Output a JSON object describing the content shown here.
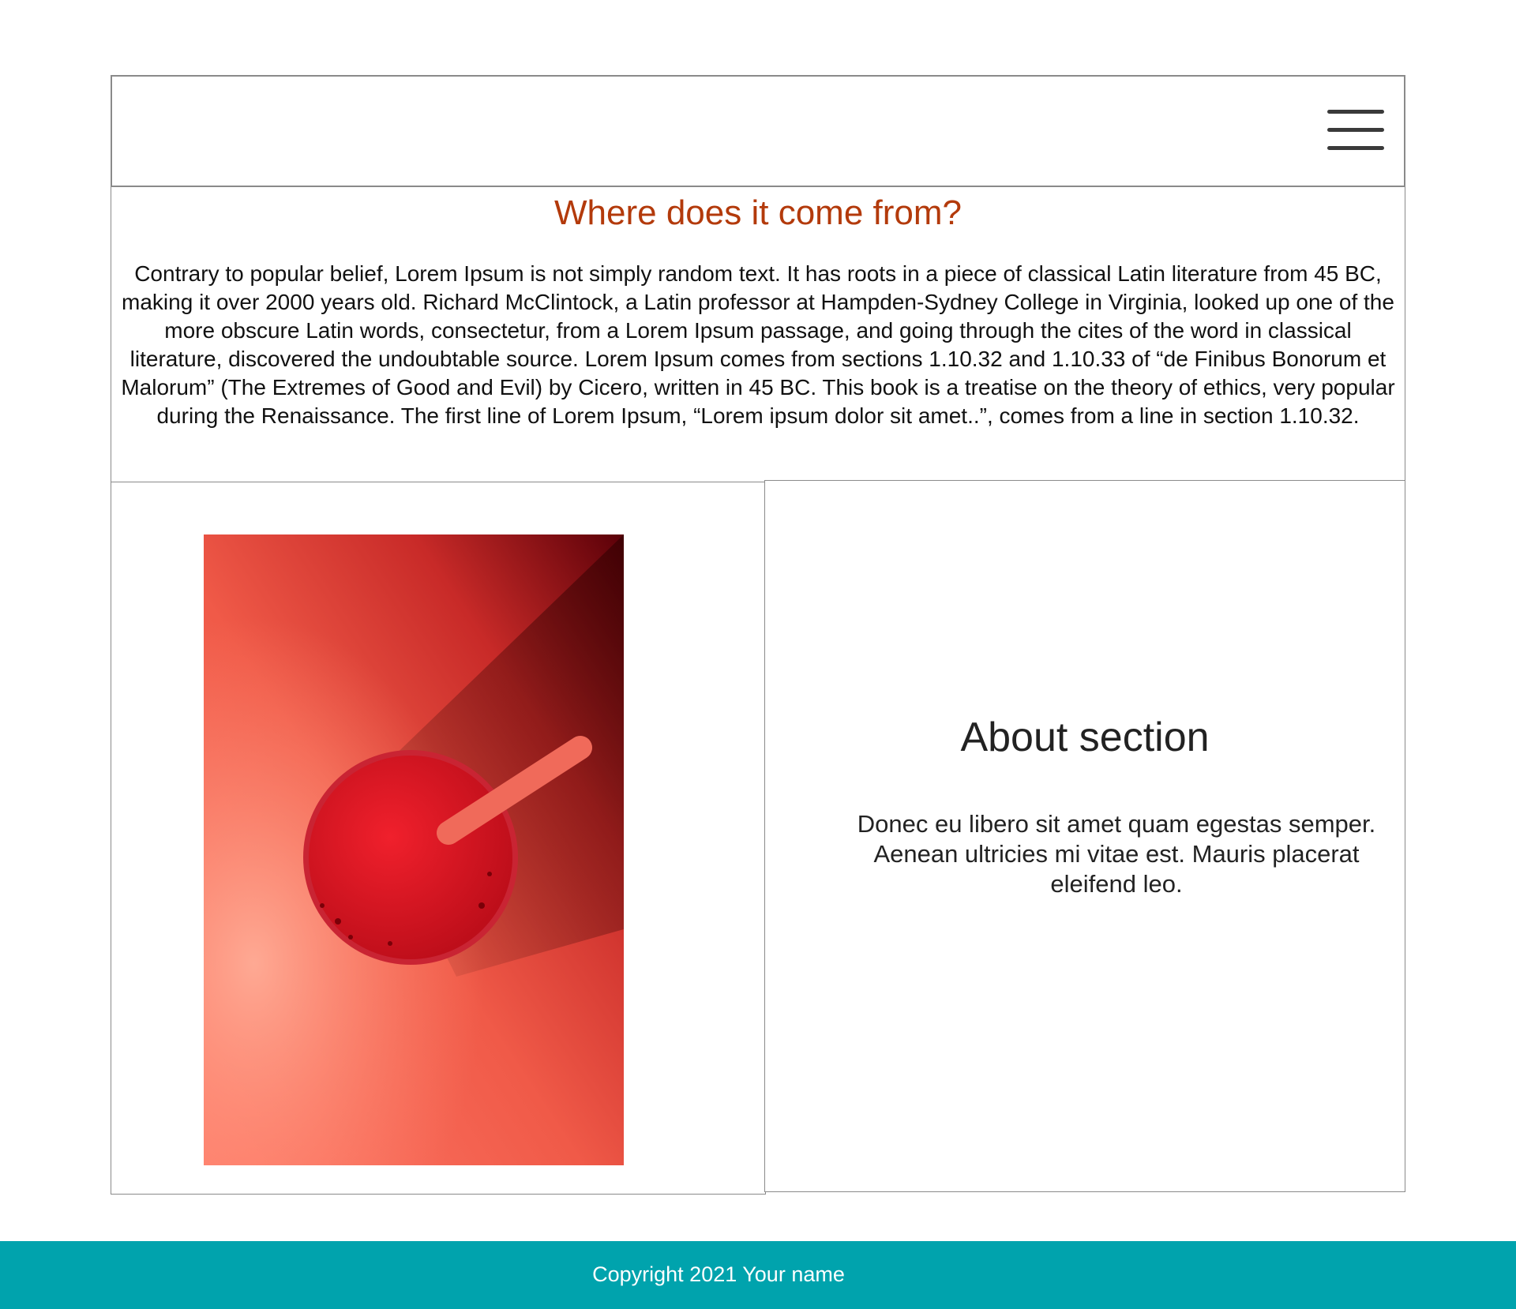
{
  "header": {
    "menu_icon": "hamburger-menu-icon"
  },
  "intro": {
    "title": "Where does it come from?",
    "text": "Contrary to popular belief, Lorem Ipsum is not simply random text. It has roots in a piece of classical Latin literature from 45 BC, making it over 2000 years old. Richard McClintock, a Latin professor at Hampden-Sydney College in Virginia, looked up one of the more obscure Latin words, consectetur, from a Lorem Ipsum passage, and going through the cites of the word in classical literature, discovered the undoubtable source. Lorem Ipsum comes from sections 1.10.32 and 1.10.33 of “de Finibus Bonorum et Malorum” (The Extremes of Good and Evil) by Cicero, written in 45 BC. This book is a treatise on the theory of ethics, very popular during the Renaissance. The first line of Lorem Ipsum, “Lorem ipsum dolor sit amet..”, comes from a line in section 1.10.32."
  },
  "image": {
    "subject": "red drink in glass with straw, top view"
  },
  "about": {
    "title": "About section",
    "text": "Donec eu libero sit amet quam egestas semper. Aenean ultricies mi vitae est. Mauris placerat eleifend leo."
  },
  "footer": {
    "copyright": "Copyright 2021 Your name"
  },
  "colors": {
    "title_accent": "#b33a0b",
    "footer_bg": "#00a3ad",
    "image_red": "#e8332f"
  }
}
